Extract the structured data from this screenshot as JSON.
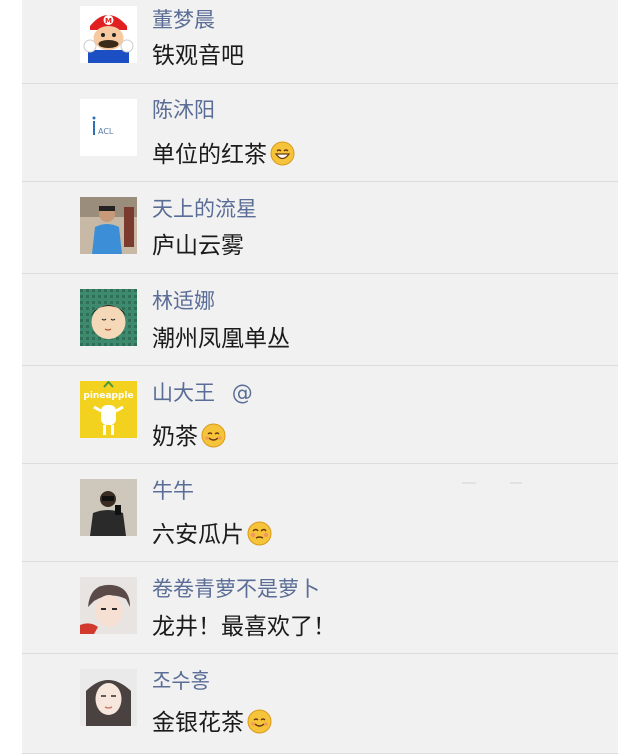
{
  "comments": [
    {
      "name": "董梦晨",
      "text": "铁观音吧",
      "avatar": "mario-avatar",
      "emoji": ""
    },
    {
      "name": "陈沐阳",
      "text": "单位的红茶",
      "avatar": "acl-logo-avatar",
      "avatar_text": "ACL",
      "emoji": "grinning-emoji"
    },
    {
      "name": "天上的流星",
      "text": "庐山云雾",
      "avatar": "man-in-blue-shirt-avatar",
      "emoji": ""
    },
    {
      "name": "林适娜",
      "text": "潮州凤凰单丛",
      "avatar": "cartoon-girl-avatar",
      "emoji": ""
    },
    {
      "name": "山大王",
      "mention": "@",
      "text": "奶茶",
      "avatar": "pineapple-avatar",
      "avatar_text": "pineapple",
      "emoji": "smile-emoji"
    },
    {
      "name": "牛牛",
      "text": "六安瓜片",
      "avatar": "mirror-selfie-avatar",
      "emoji": "blush-emoji"
    },
    {
      "name": "卷卷青萝不是萝卜",
      "text": "龙井！最喜欢了！",
      "avatar": "anime-boy-avatar",
      "emoji": ""
    },
    {
      "name": "조수홍",
      "text": "金银花茶",
      "avatar": "woman-portrait-avatar",
      "emoji": "smile-emoji"
    }
  ],
  "colors": {
    "panel_bg": "#f1f1f1",
    "name": "#5a6d96",
    "text": "#1b1b1b",
    "divider": "#dcdcdc"
  }
}
